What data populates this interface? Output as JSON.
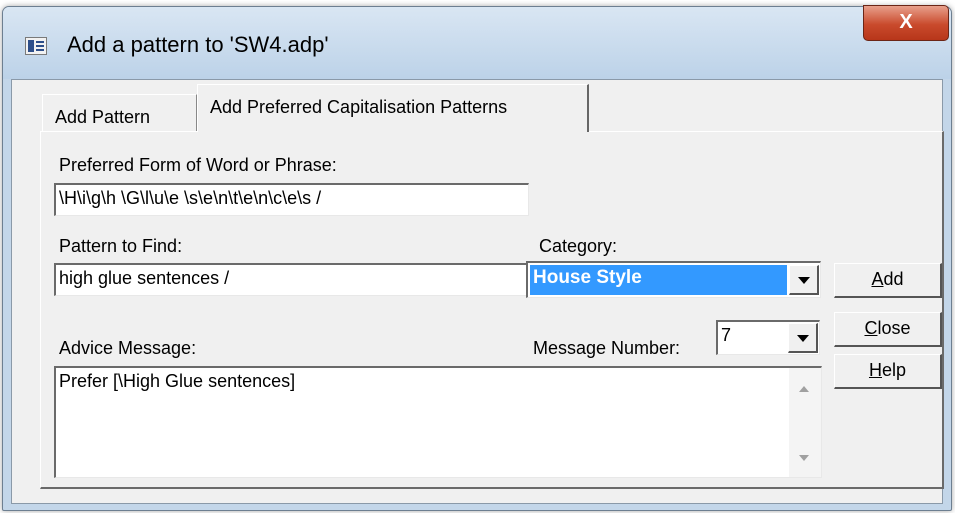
{
  "window": {
    "title": "Add a pattern to 'SW4.adp'",
    "close_glyph": "X"
  },
  "tabs": [
    {
      "label": "Add Pattern",
      "active": false
    },
    {
      "label": "Add Preferred Capitalisation Patterns",
      "active": true
    }
  ],
  "form": {
    "preferred_label": "Preferred Form of Word or Phrase:",
    "preferred_value": "\\H\\i\\g\\h \\G\\l\\u\\e \\s\\e\\n\\t\\e\\n\\c\\e\\s /",
    "pattern_label": "Pattern to Find:",
    "pattern_value": "high glue sentences /",
    "category_label": "Category:",
    "category_value": "House Style",
    "advice_label": "Advice Message:",
    "advice_value": "Prefer  [\\High Glue sentences]",
    "message_number_label": "Message Number:",
    "message_number_value": "7"
  },
  "buttons": {
    "add": {
      "accel": "A",
      "rest": "dd"
    },
    "close": {
      "accel": "C",
      "rest": "lose"
    },
    "help": {
      "accel": "H",
      "rest": "elp"
    }
  },
  "colors": {
    "selection": "#3399ff",
    "close_button": "#c94a2c",
    "dialog_face": "#f0f0f0",
    "frame": "#c3d6e9"
  },
  "icons": [
    "app-icon",
    "close-icon",
    "chevron-down-icon",
    "scroll-up-icon",
    "scroll-down-icon"
  ]
}
